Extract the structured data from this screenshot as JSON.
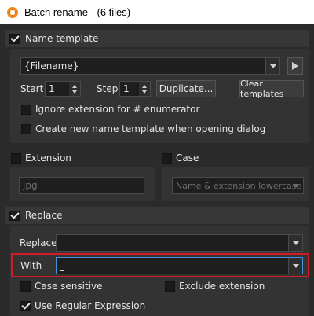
{
  "window": {
    "title": "Batch rename - (6 files)"
  },
  "name_template": {
    "header": "Name template",
    "checked": true,
    "template_value": "{Filename}",
    "start_label": "Start",
    "start_value": "1",
    "step_label": "Step",
    "step_value": "1",
    "duplicate_label": "Duplicate...",
    "clear_label": "Clear templates",
    "ignore_ext_label": "Ignore extension for # enumerator",
    "create_new_label": "Create new name template when opening dialog"
  },
  "extension": {
    "header": "Extension",
    "checked": false,
    "value": "jpg"
  },
  "case": {
    "header": "Case",
    "checked": false,
    "value": "Name & extension lowercase"
  },
  "replace": {
    "header": "Replace",
    "checked": true,
    "replace_label": "Replace",
    "replace_value": "_",
    "with_label": "With",
    "with_value": "_",
    "case_sensitive_label": "Case sensitive",
    "exclude_ext_label": "Exclude extension",
    "regex_label": "Use Regular Expression",
    "regex_checked": true
  },
  "colors": {
    "highlight": "#d01c24",
    "background": "#2b2b2b"
  }
}
